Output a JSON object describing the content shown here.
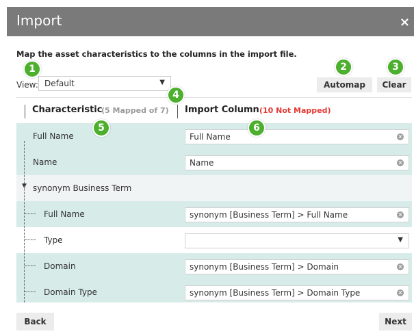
{
  "dialog": {
    "title": "Import",
    "close_glyph": "×"
  },
  "instruction": "Map the asset characteristics to the columns in the import file.",
  "view": {
    "label": "View:",
    "selected": "Default",
    "caret": "▼"
  },
  "buttons": {
    "automap": "Automap",
    "clear": "Clear",
    "back": "Back",
    "next": "Next"
  },
  "badges": {
    "b1": "1",
    "b2": "2",
    "b3": "3",
    "b4": "4",
    "b5": "5",
    "b6": "6"
  },
  "header": {
    "characteristic": "Characteristic",
    "characteristic_count": "(5 Mapped of 7)",
    "import_column": "Import Column",
    "import_count": "(10 Not Mapped)",
    "not_mapped_color": "#e53935"
  },
  "rows": [
    {
      "label": "Full Name",
      "value": "Full Name"
    },
    {
      "label": "Name",
      "value": "Name"
    },
    {
      "group": "synonym Business Term",
      "toggle": "▼"
    },
    {
      "label": "Full Name",
      "value": "synonym [Business Term] > Full Name"
    },
    {
      "label": "Type",
      "value": ""
    },
    {
      "label": "Domain",
      "value": "synonym [Business Term] > Domain"
    },
    {
      "label": "Domain Type",
      "value": "synonym [Business Term] > Domain Type"
    }
  ],
  "icons": {
    "clear": "⊗",
    "dropdown": "▼"
  },
  "colors": {
    "titlebar": "#7a7a7a",
    "row_highlight": "#d7ece8",
    "badge": "#4caf2e"
  }
}
